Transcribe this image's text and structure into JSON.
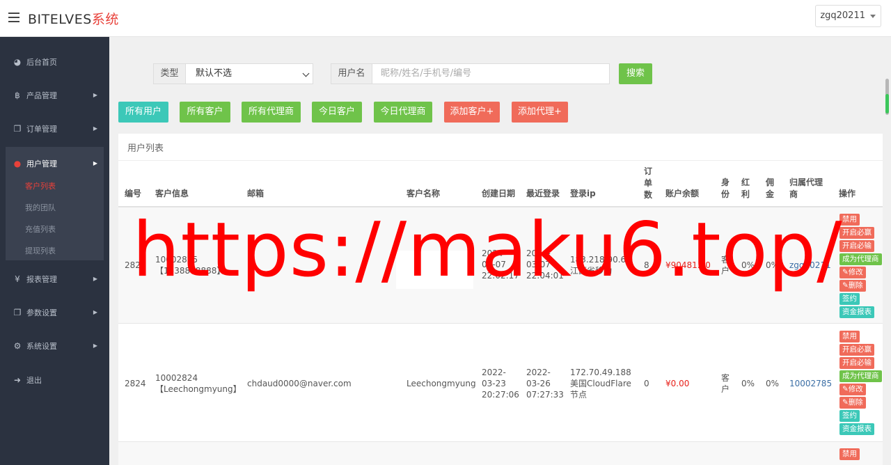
{
  "header": {
    "brand_main": "BITELVES",
    "brand_suffix": "系统",
    "user": "zgq20211"
  },
  "sidebar": {
    "items": [
      {
        "label": "后台首页",
        "icon": "dashboard-icon"
      },
      {
        "label": "产品管理",
        "icon": "bitcoin-icon"
      },
      {
        "label": "订单管理",
        "icon": "copy-icon"
      },
      {
        "label": "用户管理",
        "icon": "user-icon"
      },
      {
        "label": "报表管理",
        "icon": "yen-icon"
      },
      {
        "label": "参数设置",
        "icon": "copy-icon"
      },
      {
        "label": "系统设置",
        "icon": "gears-icon"
      },
      {
        "label": "退出",
        "icon": "sign-out-icon"
      }
    ],
    "subitems": [
      "客户列表",
      "我的团队",
      "充值列表",
      "提现列表"
    ]
  },
  "filters": {
    "type_label": "类型",
    "type_value": "默认不选",
    "username_label": "用户名",
    "username_placeholder": "昵称/姓名/手机号/编号",
    "search_button": "搜索"
  },
  "quick_buttons": [
    "所有用户",
    "所有客户",
    "所有代理商",
    "今日客户",
    "今日代理商",
    "添加客户+",
    "添加代理+"
  ],
  "panel_title": "用户列表",
  "table": {
    "headers": {
      "id": "编号",
      "info": "客户信息",
      "email": "邮箱",
      "name": "客户名称",
      "created": "创建日期",
      "last_login": "最近登录",
      "ip": "登录ip",
      "orders_1": "订",
      "orders_2": "单",
      "orders_3": "数",
      "balance": "账户余额",
      "role_1": "身",
      "role_2": "份",
      "bonus_1": "红",
      "bonus_2": "利",
      "commission_1": "佣",
      "commission_2": "金",
      "agent_1": "归属代理",
      "agent_2": "商",
      "actions": "操作"
    },
    "rows": [
      {
        "id": "2825",
        "info_1": "10002825",
        "info_2": "【1538888888】",
        "email": "",
        "name": "",
        "created_1": "2024-",
        "created_2": "03-07",
        "created_3": "22:02:17",
        "login_1": "2024-",
        "login_2": "03-07",
        "login_3": "22:04:01",
        "ip_1": "183.218.90.68",
        "ip_2": "江西省移动",
        "orders": "8",
        "balance": "¥90481.50",
        "role_1": "客",
        "role_2": "户",
        "bonus": "0%",
        "commission": "0%",
        "agent": "zgq20211"
      },
      {
        "id": "2824",
        "info_1": "10002824",
        "info_2": "【Leechongmyung】",
        "email": "chdaud0000@naver.com",
        "name": "Leechongmyung",
        "created_1": "2022-",
        "created_2": "03-23",
        "created_3": "20:27:06",
        "login_1": "2022-",
        "login_2": "03-26",
        "login_3": "07:27:33",
        "ip_1": "172.70.49.188",
        "ip_2": "美国CloudFlare",
        "ip_3": "节点",
        "orders": "0",
        "balance": "¥0.00",
        "role_1": "客",
        "role_2": "户",
        "bonus": "0%",
        "commission": "0%",
        "agent": "10002785"
      }
    ],
    "actions": [
      "禁用",
      "开启必赢",
      "开启必输",
      "成为代理商",
      "修改",
      "删除",
      "签约",
      "资金报表"
    ],
    "row3_first_action": "禁用"
  },
  "watermark": "https://maku6.top/"
}
